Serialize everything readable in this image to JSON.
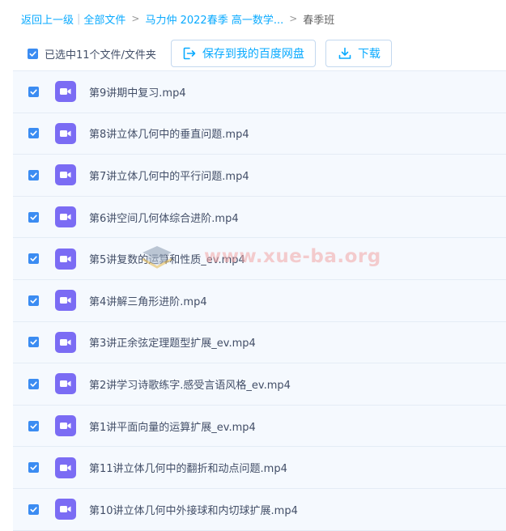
{
  "breadcrumb": {
    "back": "返回上一级",
    "all_files": "全部文件",
    "parent": "马力仲 2022春季 高一数学...",
    "current": "春季班",
    "bar_sep": "|",
    "gt_sep": ">"
  },
  "toolbar": {
    "selected_text": "已选中11个文件/文件夹",
    "save_label": "保存到我的百度网盘",
    "download_label": "下载"
  },
  "files": [
    "第9讲期中复习.mp4",
    "第8讲立体几何中的垂直问题.mp4",
    "第7讲立体几何中的平行问题.mp4",
    "第6讲空间几何体综合进阶.mp4",
    "第5讲复数的运算和性质_ev.mp4",
    "第4讲解三角形进阶.mp4",
    "第3讲正余弦定理题型扩展_ev.mp4",
    "第2讲学习诗歌练字.感受言语风格_ev.mp4",
    "第1讲平面向量的运算扩展_ev.mp4",
    "第11讲立体几何中的翻折和动点问题.mp4",
    "第10讲立体几何中外接球和内切球扩展.mp4"
  ],
  "icons": {
    "checkbox": "checkbox-checked-icon",
    "file": "video-file-icon",
    "save": "save-to-netdisk-icon",
    "download": "download-icon"
  },
  "colors": {
    "link": "#09AAFF",
    "checkbox": "#3B8CF2",
    "video_icon": "#7B6CF4",
    "row_bg": "#f5f9fe"
  },
  "watermark": "www.xue-ba.org"
}
